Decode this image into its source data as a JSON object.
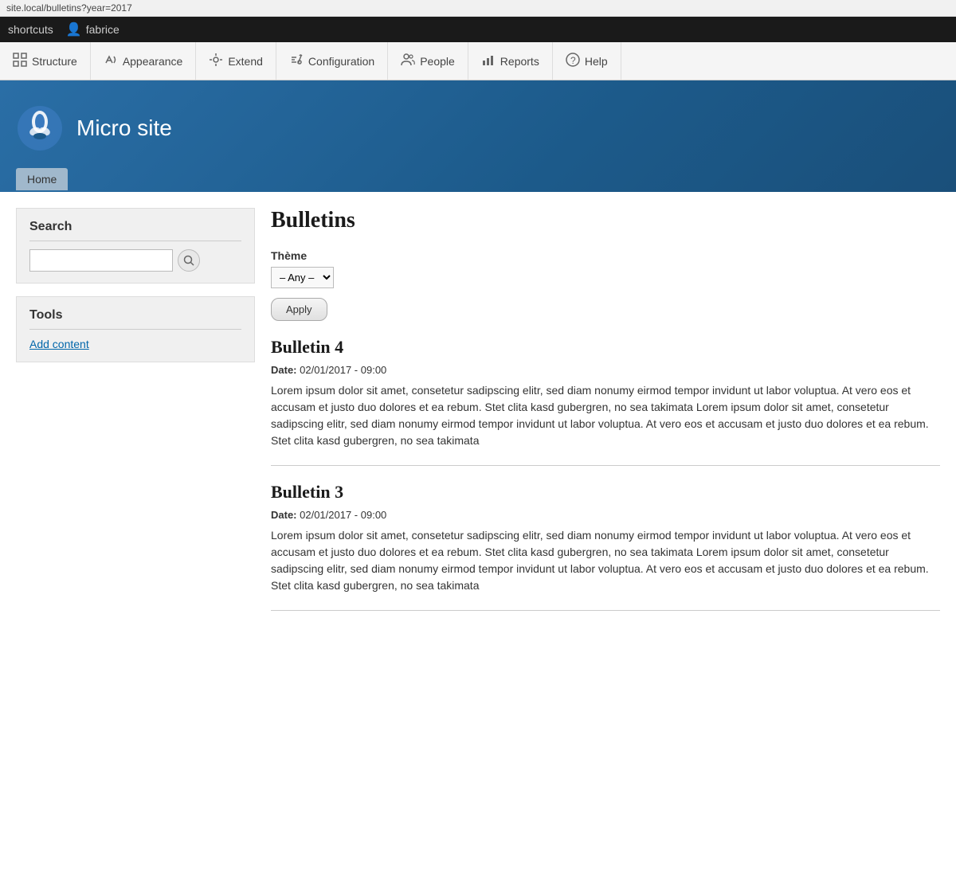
{
  "browser": {
    "url": "site.local/bulletins?year=2017"
  },
  "admin_bar": {
    "shortcuts_label": "shortcuts",
    "user_label": "fabrice"
  },
  "nav": {
    "items": [
      {
        "id": "structure",
        "label": "Structure",
        "icon": "⊞"
      },
      {
        "id": "appearance",
        "label": "Appearance",
        "icon": "🖌"
      },
      {
        "id": "extend",
        "label": "Extend",
        "icon": "⚙"
      },
      {
        "id": "configuration",
        "label": "Configuration",
        "icon": "🔧"
      },
      {
        "id": "people",
        "label": "People",
        "icon": "👤"
      },
      {
        "id": "reports",
        "label": "Reports",
        "icon": "📊"
      },
      {
        "id": "help",
        "label": "Help",
        "icon": "?"
      }
    ]
  },
  "hero": {
    "site_title": "Micro site",
    "home_tab": "Home"
  },
  "sidebar": {
    "search_block": {
      "title": "Search",
      "input_placeholder": ""
    },
    "tools_block": {
      "title": "Tools",
      "add_content_label": "Add content"
    }
  },
  "main": {
    "page_title": "Bulletins",
    "filter": {
      "label": "Thème",
      "options": [
        "– Any –"
      ],
      "selected": "– Any –",
      "apply_label": "Apply"
    },
    "bulletins": [
      {
        "id": "bulletin-4",
        "title": "Bulletin 4",
        "date_label": "Date:",
        "date_value": "02/01/2017 - 09:00",
        "body": "Lorem ipsum dolor sit amet, consetetur sadipscing elitr, sed diam nonumy eirmod tempor invidunt ut labor voluptua. At vero eos et accusam et justo duo dolores et ea rebum. Stet clita kasd gubergren, no sea takimata Lorem ipsum dolor sit amet, consetetur sadipscing elitr, sed diam nonumy eirmod tempor invidunt ut labor voluptua. At vero eos et accusam et justo duo dolores et ea rebum. Stet clita kasd gubergren, no sea takimata"
      },
      {
        "id": "bulletin-3",
        "title": "Bulletin 3",
        "date_label": "Date:",
        "date_value": "02/01/2017 - 09:00",
        "body": "Lorem ipsum dolor sit amet, consetetur sadipscing elitr, sed diam nonumy eirmod tempor invidunt ut labor voluptua. At vero eos et accusam et justo duo dolores et ea rebum. Stet clita kasd gubergren, no sea takimata Lorem ipsum dolor sit amet, consetetur sadipscing elitr, sed diam nonumy eirmod tempor invidunt ut labor voluptua. At vero eos et accusam et justo duo dolores et ea rebum. Stet clita kasd gubergren, no sea takimata"
      }
    ]
  }
}
